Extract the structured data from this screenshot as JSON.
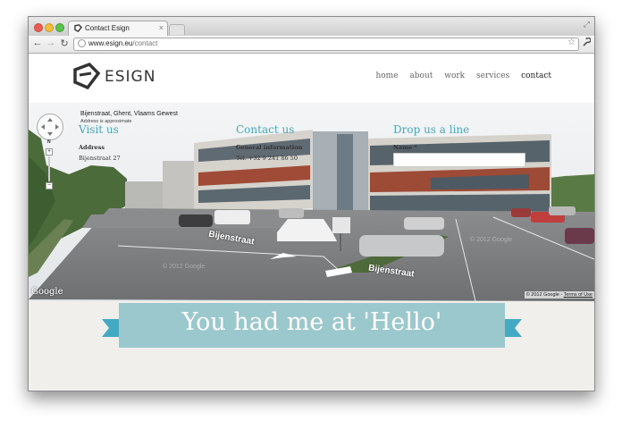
{
  "browser": {
    "tab_title": "Contact Esign",
    "tab_close": "×",
    "url_host": "www.esign.eu",
    "url_path": "/contact",
    "back": "←",
    "forward": "→",
    "reload": "↻",
    "star": "☆",
    "wrench": "🔧",
    "resize": "⤢"
  },
  "site": {
    "logo_text": "ESIGN",
    "nav": [
      "home",
      "about",
      "work",
      "services",
      "contact"
    ],
    "active_nav": "contact"
  },
  "streetview": {
    "address": "Bijenstraat, Ghent, Vlaams Gewest",
    "approx": "Address is approximate",
    "road_labels": [
      "Bijenstraat",
      "Bijenstraat"
    ],
    "watermarks": [
      "© 2012 Google",
      "© 2012 Google"
    ],
    "google_logo": "Google",
    "copyright": "© 2012 Google - ",
    "terms": "Terms of Use",
    "compass_n": "N",
    "zoom_plus": "+",
    "zoom_minus": "−"
  },
  "banner": {
    "text": "You had me at 'Hello'",
    "color": "#9ac8cc"
  },
  "footer": {
    "visit": {
      "title": "Visit us",
      "sub": "Address",
      "line": "Bijenstraat 27"
    },
    "contact": {
      "title": "Contact us",
      "sub": "General information",
      "line": "Tel. +32 9 241 86 50"
    },
    "drop": {
      "title": "Drop us a line",
      "sub": "Name *"
    },
    "accent": "#4aa6ba"
  }
}
